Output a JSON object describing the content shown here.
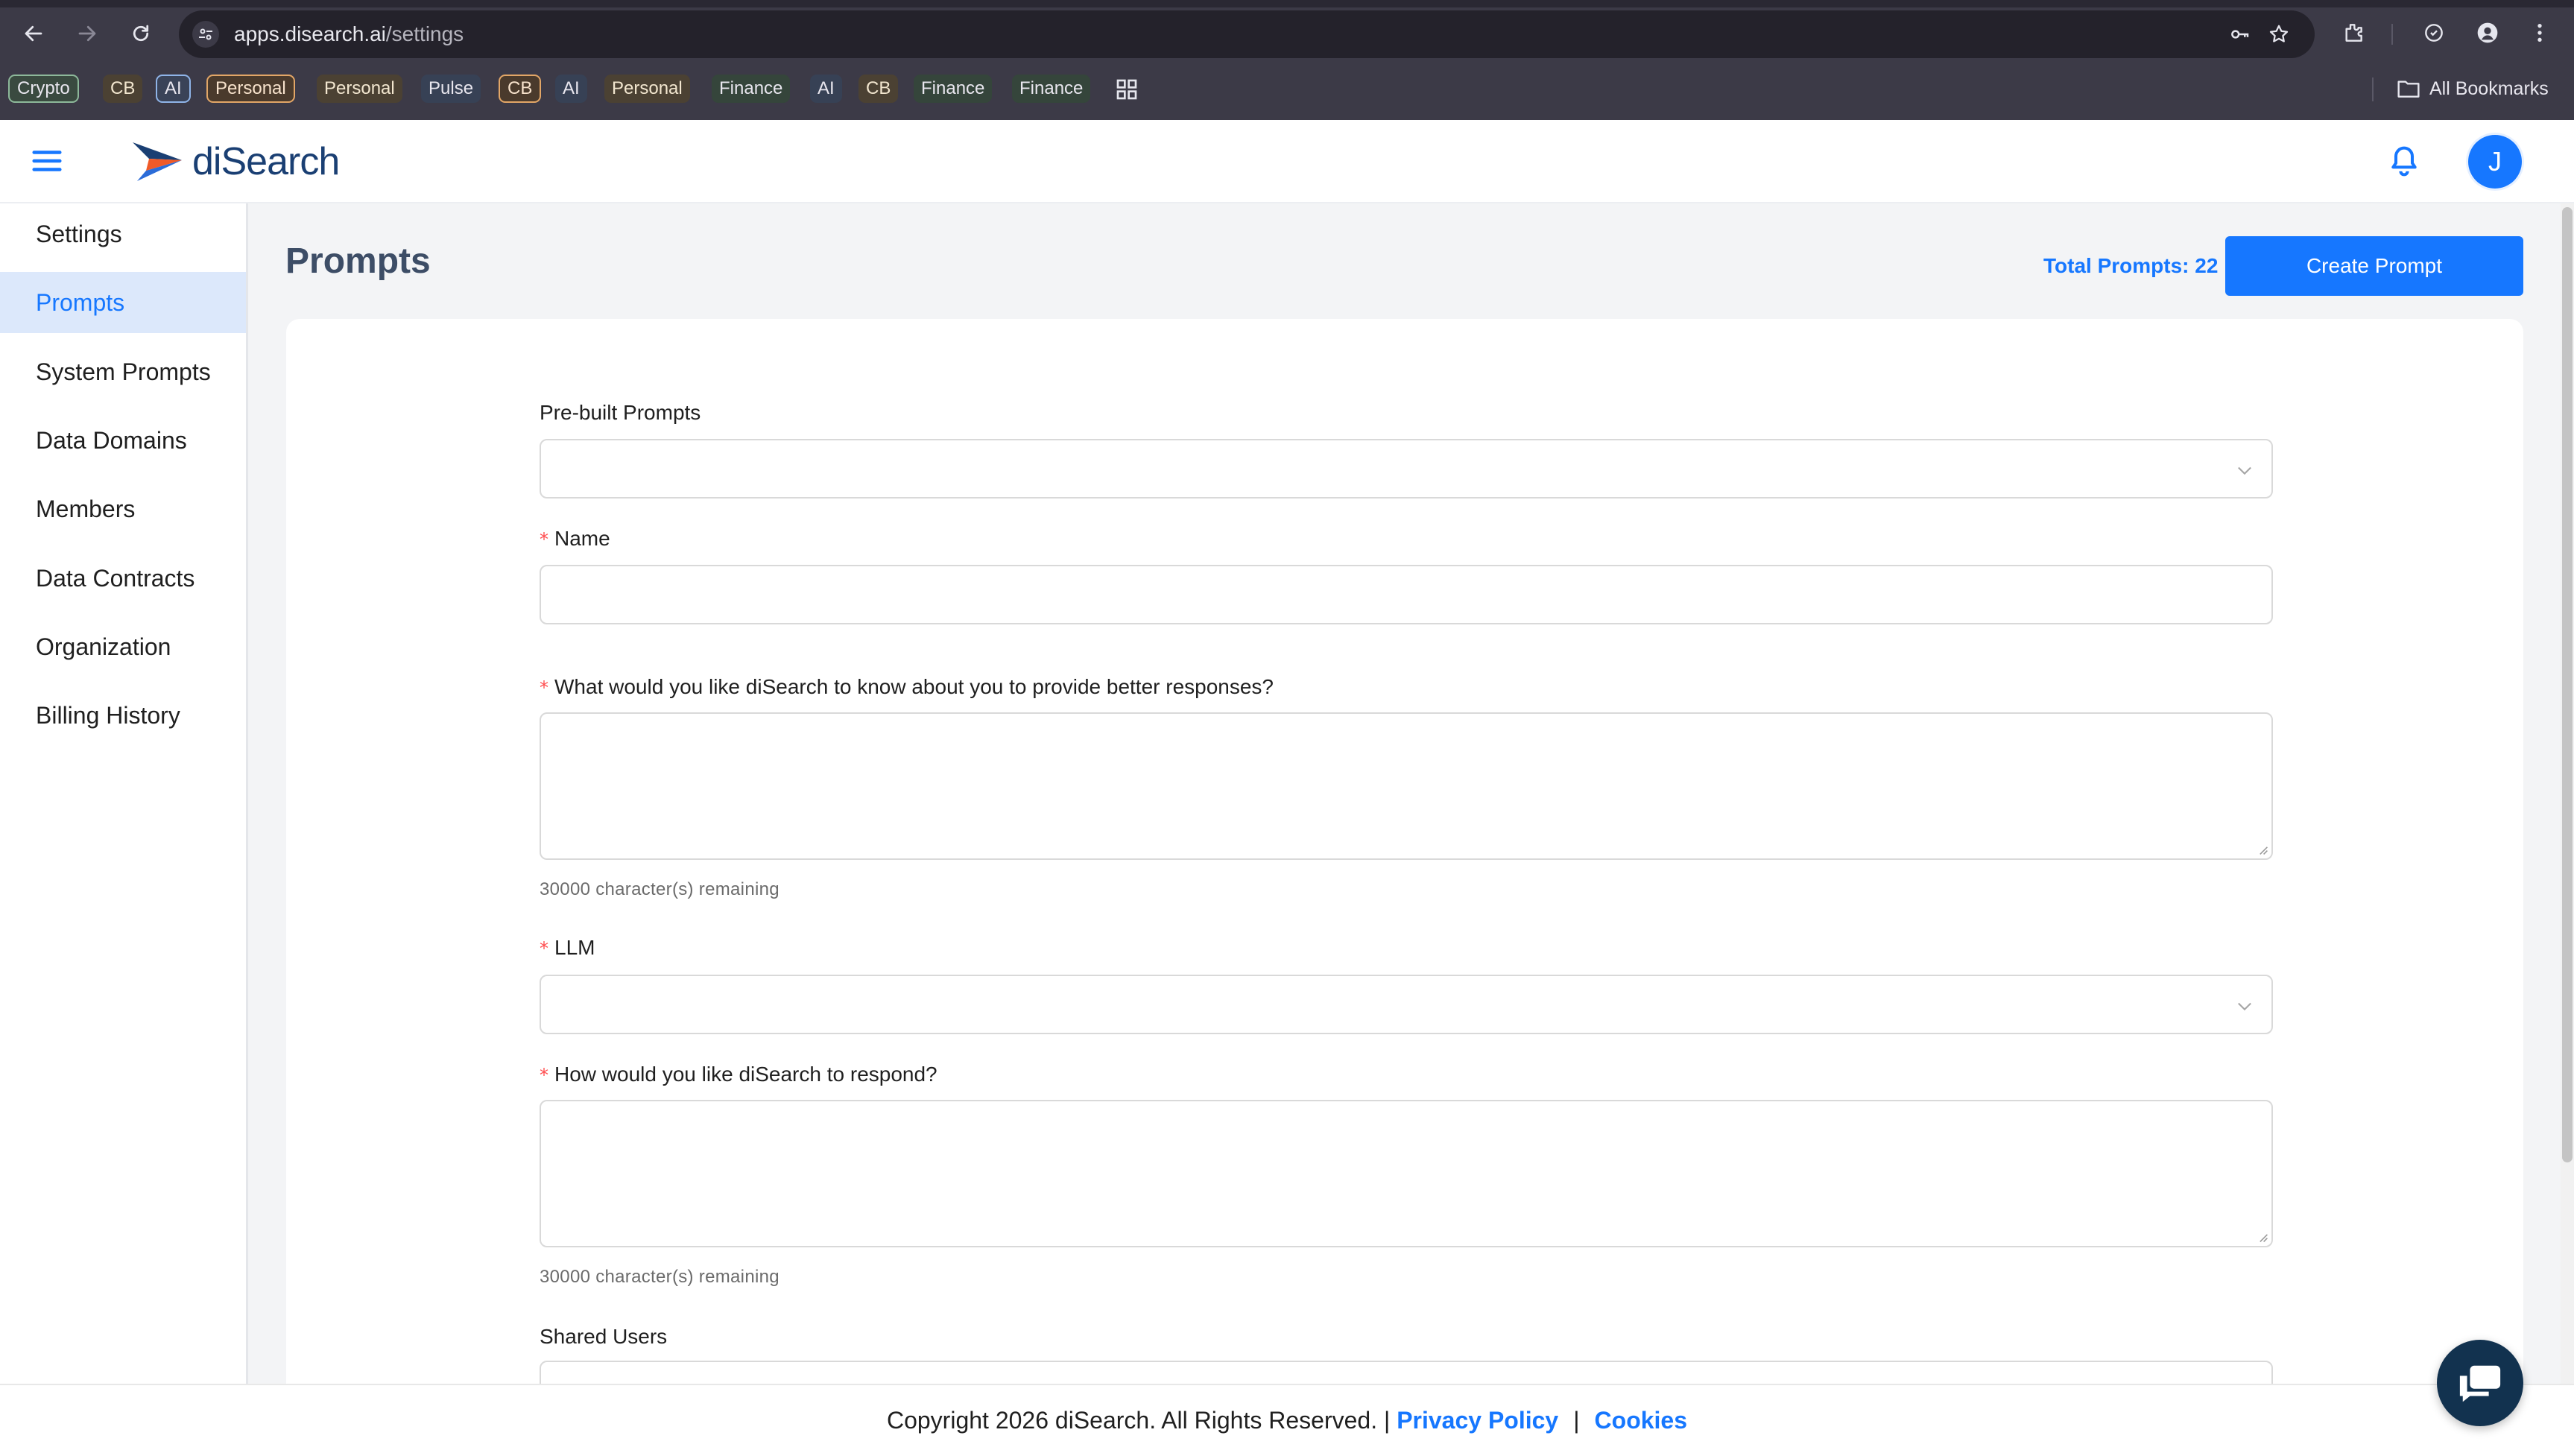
{
  "browser": {
    "url_host": "apps.disearch.ai",
    "url_path": "/settings",
    "bookmarks": [
      {
        "label": "Crypto",
        "style": "outline-green"
      },
      {
        "label": "CB",
        "style": "tan"
      },
      {
        "label": "AI",
        "style": "outline-blue"
      },
      {
        "label": "Personal",
        "style": "outline-orange"
      },
      {
        "label": "Personal",
        "style": "tan"
      },
      {
        "label": "Pulse",
        "style": "plain-blue"
      },
      {
        "label": "CB",
        "style": "outline-orange"
      },
      {
        "label": "AI",
        "style": "plain-blue"
      },
      {
        "label": "Personal",
        "style": "tan"
      },
      {
        "label": "Finance",
        "style": "plain-green"
      },
      {
        "label": "AI",
        "style": "plain-blue"
      },
      {
        "label": "CB",
        "style": "tan"
      },
      {
        "label": "Finance",
        "style": "plain-green"
      },
      {
        "label": "Finance",
        "style": "plain-green"
      }
    ],
    "all_bookmarks_label": "All Bookmarks"
  },
  "app": {
    "logo_text": "diSearch",
    "avatar_initial": "J",
    "brand_color": "#1677ff"
  },
  "sidebar": {
    "items": [
      {
        "label": "Settings",
        "active": false
      },
      {
        "label": "Prompts",
        "active": true
      },
      {
        "label": "System Prompts",
        "active": false
      },
      {
        "label": "Data Domains",
        "active": false
      },
      {
        "label": "Members",
        "active": false
      },
      {
        "label": "Data Contracts",
        "active": false
      },
      {
        "label": "Organization",
        "active": false
      },
      {
        "label": "Billing History",
        "active": false
      }
    ]
  },
  "main": {
    "title": "Prompts",
    "total_prompts": "Total Prompts: 22",
    "create_button": "Create Prompt"
  },
  "form": {
    "prebuilt_label": "Pre-built Prompts",
    "prebuilt_value": "",
    "name_label": "Name",
    "name_value": "",
    "about_label": "What would you like diSearch to know about you to provide better responses?",
    "about_value": "",
    "about_remaining": "30000 character(s) remaining",
    "llm_label": "LLM",
    "llm_value": "",
    "respond_label": "How would you like diSearch to respond?",
    "respond_value": "",
    "respond_remaining": "30000 character(s) remaining",
    "shared_users_label": "Shared Users",
    "required_marker": "*"
  },
  "footer": {
    "copyright": "Copyright 2026 diSearch. All Rights Reserved. |",
    "privacy": "Privacy Policy",
    "separator": "|",
    "cookies": "Cookies"
  }
}
